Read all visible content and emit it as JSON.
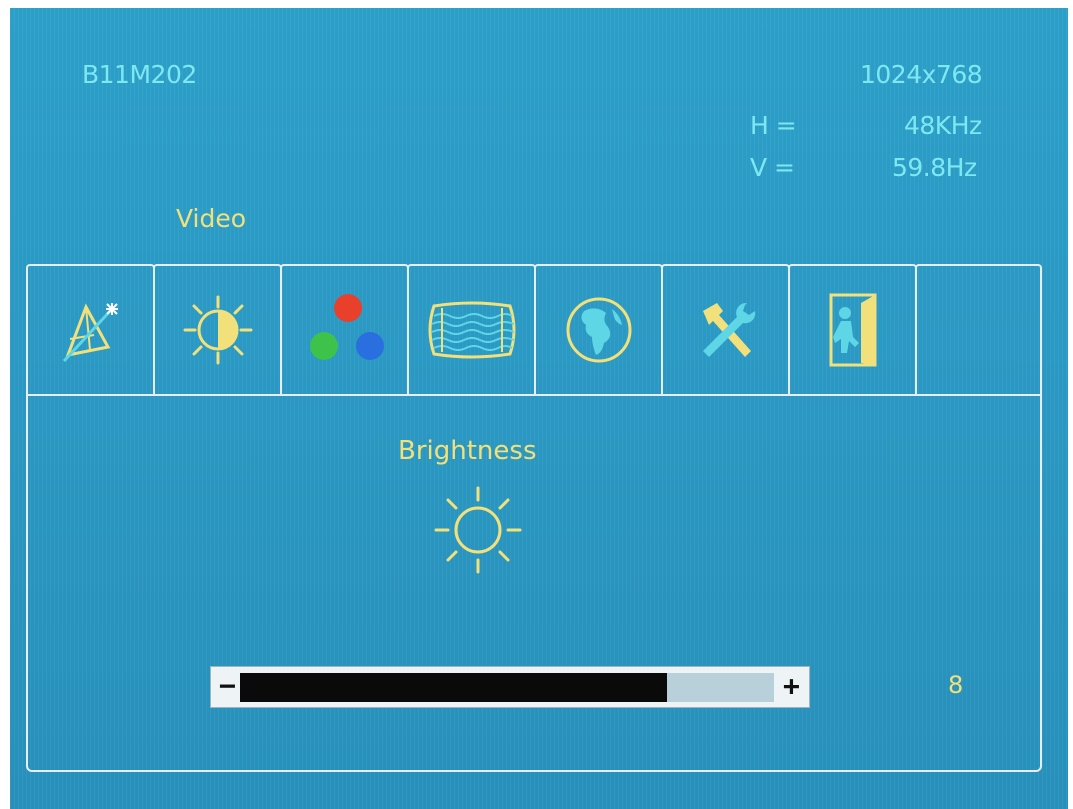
{
  "model": "B11M202",
  "resolution": "1024x768",
  "h_label": "H =",
  "h_value": "48KHz",
  "v_label": "V =",
  "v_value": "59.8Hz",
  "section_title": "Video",
  "tabs": [
    {
      "icon": "video-pyramid-icon"
    },
    {
      "icon": "brightness-contrast-icon"
    },
    {
      "icon": "color-dots-icon"
    },
    {
      "icon": "image-geometry-icon"
    },
    {
      "icon": "globe-language-icon"
    },
    {
      "icon": "tools-icon"
    },
    {
      "icon": "exit-door-icon"
    },
    {
      "icon": ""
    }
  ],
  "active_item": {
    "label": "Brightness",
    "icon": "sun-icon"
  },
  "slider": {
    "minus": "−",
    "plus": "+",
    "value": "8",
    "fill_fraction": 0.8
  },
  "colors": {
    "background": "#2a98c2",
    "info_text": "#7ee8f0",
    "accent_text": "#f2e07a"
  }
}
